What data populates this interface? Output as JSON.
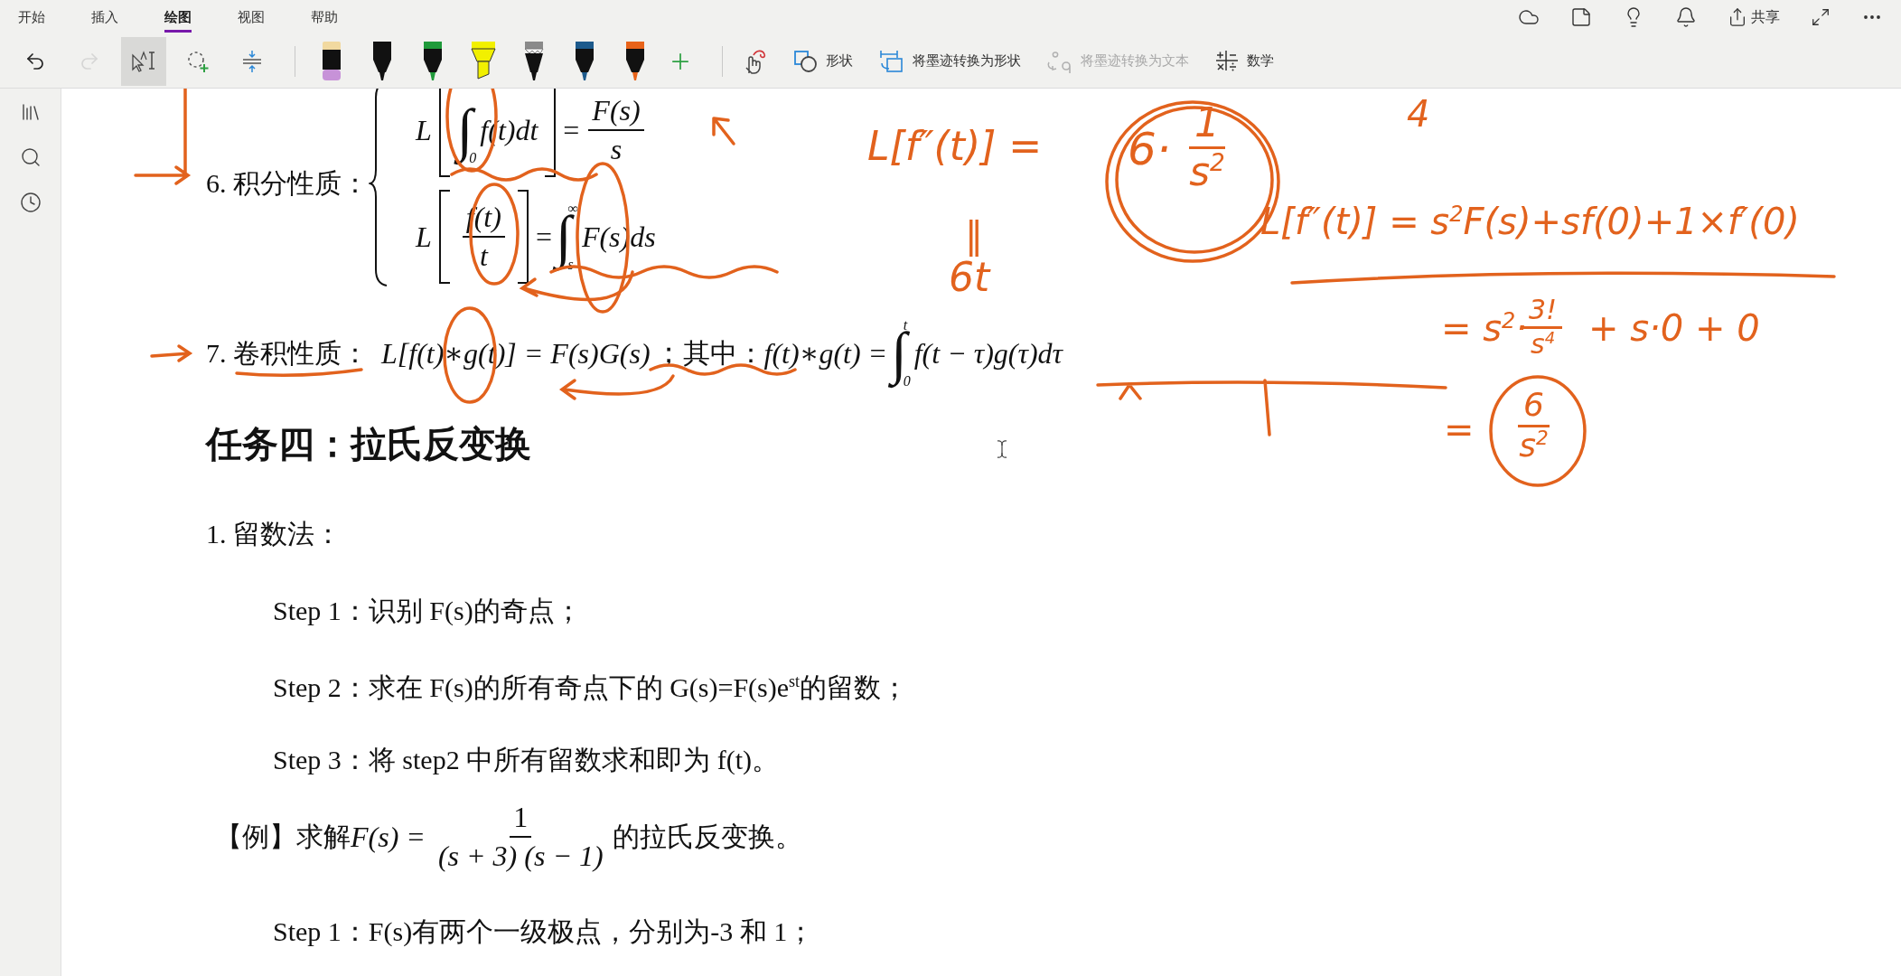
{
  "tabs": [
    {
      "label": "开始",
      "selected": false
    },
    {
      "label": "插入",
      "selected": false
    },
    {
      "label": "绘图",
      "selected": true
    },
    {
      "label": "视图",
      "selected": false
    },
    {
      "label": "帮助",
      "selected": false
    }
  ],
  "share_label": "共享",
  "tools": [
    {
      "kind": "undo",
      "disabled": false
    },
    {
      "kind": "redo",
      "disabled": true
    },
    {
      "kind": "lasso-text",
      "selected": true
    },
    {
      "kind": "lasso-add",
      "selected": false
    },
    {
      "kind": "insert-space",
      "selected": false
    }
  ],
  "pens": [
    {
      "kind": "marker",
      "color": "#c792d8"
    },
    {
      "kind": "pen",
      "color": "#111111"
    },
    {
      "kind": "pen",
      "color": "#1f9a3a"
    },
    {
      "kind": "highlighter",
      "color": "#f2f000"
    },
    {
      "kind": "pencil",
      "color": "#8a8a8a"
    },
    {
      "kind": "pen",
      "color": "#1d5a8c"
    },
    {
      "kind": "pen",
      "color": "#e8631a"
    }
  ],
  "actions": [
    {
      "kind": "add-pen",
      "disabled": false
    },
    {
      "kind": "touch-draw",
      "disabled": false
    },
    {
      "kind": "shapes",
      "label": "形状",
      "disabled": false
    },
    {
      "kind": "ink-to-shape",
      "label": "将墨迹转换为形状",
      "disabled": false
    },
    {
      "kind": "ink-to-text",
      "label": "将墨迹转换为文本",
      "disabled": true
    },
    {
      "kind": "math",
      "label": "数学",
      "disabled": false
    }
  ],
  "property6": {
    "label": "6. 积分性质：",
    "eq1": {
      "op": "L",
      "integral": "∫",
      "lower": "0",
      "integrand": "f(t)dt",
      "equals": "=",
      "num": "F(s)",
      "den": "s"
    },
    "eq2": {
      "op": "L",
      "num": "f(t)",
      "den": "t",
      "equals": "=",
      "integral": "∫",
      "upper": "∞",
      "lower": "s",
      "integrand": "F(s)ds"
    }
  },
  "property7": {
    "number": "7. ",
    "name": "卷积性质",
    "colon": "：",
    "formula": "L[f(t)∗g(t)] = F(s)G(s)",
    "semicolon": "；",
    "where": "其中：",
    "lhs": "f(t)∗g(t) =",
    "integral": "∫",
    "upper": "t",
    "lower": "0",
    "integrand": "f(t − τ)g(τ)dτ"
  },
  "heading": "任务四：拉氏反变换",
  "method": "1. 留数法：",
  "steps": [
    "Step 1：识别 F(s)的奇点；",
    "Step 2：求在 F(s)的所有奇点下的 G(s)=F(s)e$^{st}$的留数；",
    "Step 3：将 step2 中所有留数求和即为 f(t)。"
  ],
  "example": {
    "prefix": "【例】求解",
    "lhs": "F(s) =",
    "num": "1",
    "den": "(s + 3) (s − 1)",
    "suffix": "的拉氏反变换。"
  },
  "solution_step": "Step 1：F(s)有两个一级极点，分别为-3 和 1；",
  "ink_notes": [
    {
      "kind": "text",
      "text": "L[f″(t)] ="
    },
    {
      "kind": "text",
      "text": "6·"
    },
    {
      "kind": "fraction",
      "num": "1",
      "den": "s$^{2}$"
    },
    {
      "kind": "text",
      "text": "‖"
    },
    {
      "kind": "text",
      "text": "6t"
    },
    {
      "kind": "text",
      "text": "4"
    },
    {
      "kind": "text",
      "text": "L[f″(t)] = s$^{2}$F(s)+sf(0)+1×f′(0)"
    },
    {
      "kind": "text",
      "text": "= s$^{2}$·"
    },
    {
      "kind": "fraction",
      "num": "3!",
      "den": "s$^{4}$"
    },
    {
      "kind": "text",
      "text": "+ s·0 + 0"
    },
    {
      "kind": "text",
      "text": "="
    },
    {
      "kind": "fraction",
      "num": "6",
      "den": "s$^{2}$"
    }
  ]
}
